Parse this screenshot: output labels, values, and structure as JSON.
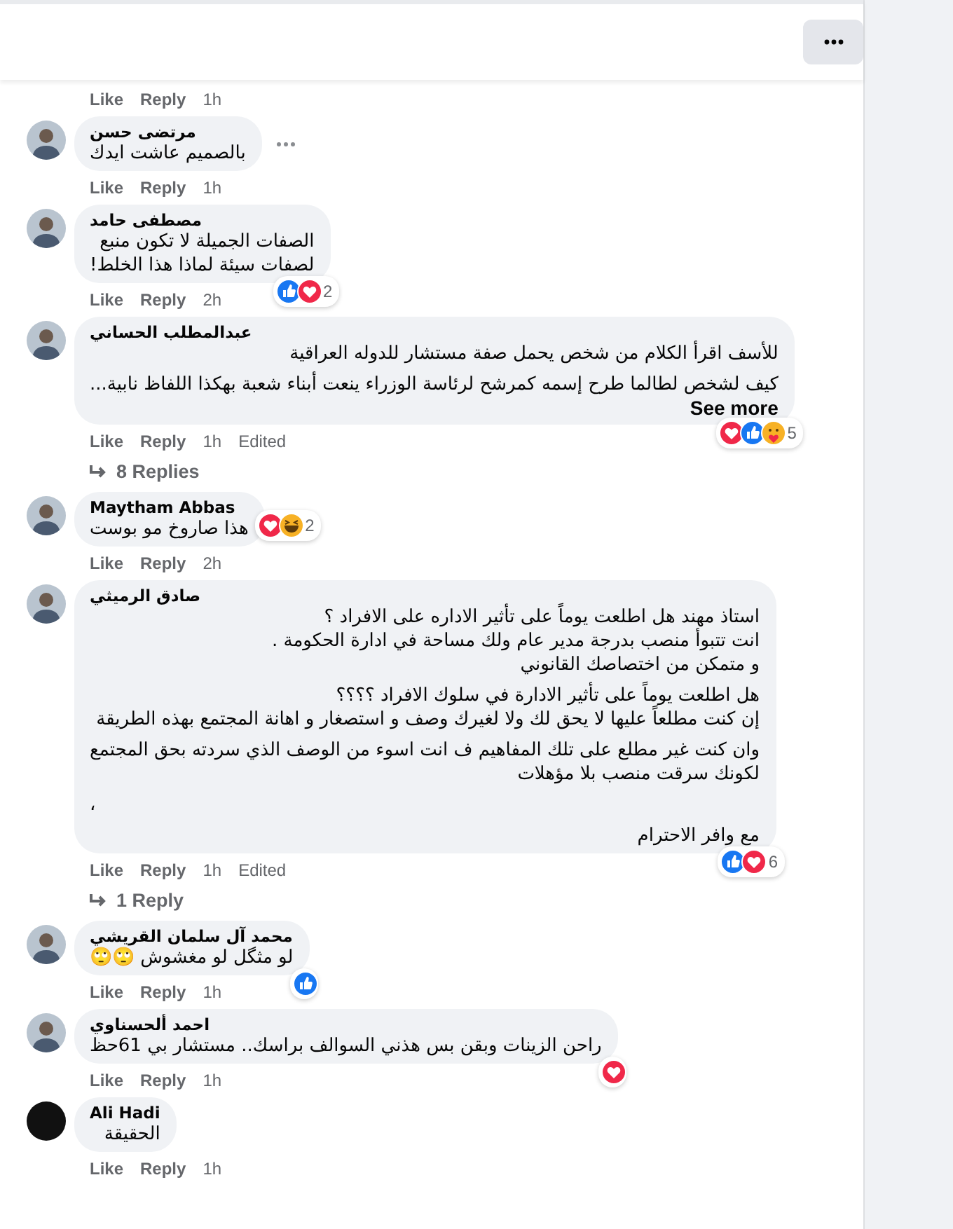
{
  "items": [
    {
      "kind": "actions",
      "like": "Like",
      "reply": "Reply",
      "time": "1h"
    },
    {
      "kind": "comment",
      "name": "مرتضى حسن",
      "paragraphs": [
        "بالصميم عاشت ايدك"
      ],
      "more_button": true,
      "like": "Like",
      "reply": "Reply",
      "time": "1h"
    },
    {
      "kind": "comment",
      "name": "مصطفى حامد",
      "paragraphs": [
        "الصفات الجميلة لا تكون منبع\nلصفات سيئة لماذا هذا الخلط!"
      ],
      "reactions": [
        {
          "kind": "like"
        },
        {
          "kind": "love"
        }
      ],
      "reaction_count": "2",
      "like": "Like",
      "reply": "Reply",
      "time": "2h"
    },
    {
      "kind": "comment",
      "name": "عبدالمطلب الحساني",
      "paragraphs": [
        "للأسف اقرأ الكلام من شخص يحمل صفة مستشار للدوله العراقية",
        "كيف لشخص لطالما طرح إسمه كمرشح لرئاسة الوزراء ينعت أبناء شعبة بهكذا اللفاظ نابية..."
      ],
      "see_more": "See more",
      "reactions": [
        {
          "kind": "love"
        },
        {
          "kind": "like"
        },
        {
          "kind": "care"
        }
      ],
      "reaction_count": "5",
      "like": "Like",
      "reply": "Reply",
      "time": "1h",
      "edited": "Edited"
    },
    {
      "kind": "replies",
      "label": "8 Replies"
    },
    {
      "kind": "comment",
      "name": "Maytham Abbas",
      "paragraphs": [
        "هذا صاروخ مو بوست"
      ],
      "reactions": [
        {
          "kind": "love"
        },
        {
          "kind": "haha"
        }
      ],
      "reaction_count": "2",
      "badge_inline": true,
      "like": "Like",
      "reply": "Reply",
      "time": "2h"
    },
    {
      "kind": "comment",
      "name": "صادق الرميثي",
      "paragraphs": [
        "استاذ مهند هل اطلعت يوماً على تأثير الاداره على الافراد ؟\nانت تتبوأ منصب بدرجة مدير عام ولك مساحة في ادارة الحكومة .\nو متمكن من اختصاصك القانوني",
        "هل اطلعت يوماً على تأثير الادارة في سلوك الافراد ؟؟؟؟\nإن كنت مطلعاً عليها لا يحق لك ولا لغيرك وصف و استصغار و اهانة المجتمع بهذه الطريقة",
        "وان كنت غير مطلع على تلك المفاهيم ف انت اسوء من الوصف الذي سردته بحق المجتمع\nلكونك سرقت منصب بلا مؤهلات",
        "،",
        "مع وافر الاحترام"
      ],
      "reactions": [
        {
          "kind": "like"
        },
        {
          "kind": "love"
        }
      ],
      "reaction_count": "6",
      "like": "Like",
      "reply": "Reply",
      "time": "1h",
      "edited": "Edited"
    },
    {
      "kind": "replies",
      "label": "1 Reply"
    },
    {
      "kind": "comment",
      "name": "محمد آل سلمان القريشي",
      "paragraphs": [
        "لو مثگل لو مغشوش 🙄🙄"
      ],
      "reactions": [
        {
          "kind": "like"
        }
      ],
      "like": "Like",
      "reply": "Reply",
      "time": "1h"
    },
    {
      "kind": "comment",
      "name": "احمد ألحسناوي",
      "paragraphs": [
        "راحن الزينات وبقن بس هذني السوالف براسك.. مستشار بي 61حظ"
      ],
      "reactions": [
        {
          "kind": "love"
        }
      ],
      "like": "Like",
      "reply": "Reply",
      "time": "1h"
    },
    {
      "kind": "comment",
      "name": "Ali Hadi",
      "paragraphs": [
        "الحقيقة"
      ],
      "avatar_dark": true,
      "like": "Like",
      "reply": "Reply",
      "time": "1h"
    }
  ]
}
